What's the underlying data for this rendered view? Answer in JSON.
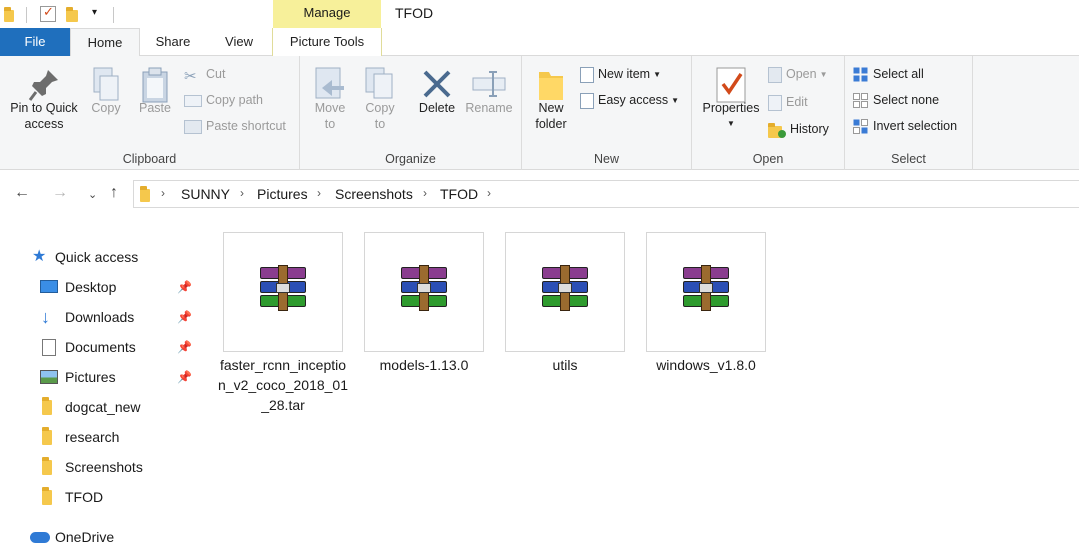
{
  "window": {
    "title": "TFOD",
    "context_tab": "Manage"
  },
  "tabs": {
    "file": "File",
    "home": "Home",
    "share": "Share",
    "view": "View",
    "picture_tools": "Picture Tools"
  },
  "ribbon": {
    "clipboard": {
      "label": "Clipboard",
      "pin_to_quick_access": "Pin to Quick\naccess",
      "copy": "Copy",
      "paste": "Paste",
      "cut": "Cut",
      "copy_path": "Copy path",
      "paste_shortcut": "Paste shortcut"
    },
    "organize": {
      "label": "Organize",
      "move_to": "Move\nto",
      "copy_to": "Copy\nto",
      "delete": "Delete",
      "rename": "Rename"
    },
    "new": {
      "label": "New",
      "new_folder": "New\nfolder",
      "new_item": "New item",
      "easy_access": "Easy access"
    },
    "open": {
      "label": "Open",
      "properties": "Properties",
      "open": "Open",
      "edit": "Edit",
      "history": "History"
    },
    "select": {
      "label": "Select",
      "select_all": "Select all",
      "select_none": "Select none",
      "invert_selection": "Invert selection"
    }
  },
  "address": {
    "crumbs": [
      "SUNNY",
      "Pictures",
      "Screenshots",
      "TFOD"
    ]
  },
  "nav": {
    "quick_access": "Quick access",
    "items": [
      {
        "label": "Desktop",
        "pinned": true,
        "icon": "desktop-icon"
      },
      {
        "label": "Downloads",
        "pinned": true,
        "icon": "download-icon"
      },
      {
        "label": "Documents",
        "pinned": true,
        "icon": "document-icon"
      },
      {
        "label": "Pictures",
        "pinned": true,
        "icon": "pictures-icon"
      },
      {
        "label": "dogcat_new",
        "pinned": false,
        "icon": "folder-icon"
      },
      {
        "label": "research",
        "pinned": false,
        "icon": "folder-icon"
      },
      {
        "label": "Screenshots",
        "pinned": false,
        "icon": "folder-icon"
      },
      {
        "label": "TFOD",
        "pinned": false,
        "icon": "folder-icon"
      }
    ],
    "onedrive": "OneDrive"
  },
  "files": [
    {
      "name": "faster_rcnn_inception_v2_coco_2018_01_28.tar",
      "icon": "winrar-archive-icon"
    },
    {
      "name": "models-1.13.0",
      "icon": "winrar-archive-icon"
    },
    {
      "name": "utils",
      "icon": "winrar-archive-icon"
    },
    {
      "name": "windows_v1.8.0",
      "icon": "winrar-archive-icon"
    }
  ]
}
